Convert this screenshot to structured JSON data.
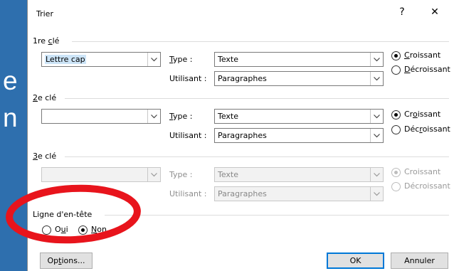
{
  "background": {
    "line1": "e",
    "line2": "n"
  },
  "dialog": {
    "title": "Trier",
    "help": "?",
    "close": "✕"
  },
  "keys": [
    {
      "label_pre": "1re ",
      "label_u": "c",
      "label_post": "lé",
      "value": "Lettre cap",
      "type_label_u": "T",
      "type_label_post": "ype :",
      "type_value": "Texte",
      "using_label": "Utilisant :",
      "using_value": "Paragraphes",
      "asc_pre": "",
      "asc_u": "C",
      "asc_post": "roissant",
      "desc_pre": "",
      "desc_u": "D",
      "desc_post": "écroissant"
    },
    {
      "label_pre": "",
      "label_u": "2",
      "label_post": "e clé",
      "value": "",
      "type_label_u": "T",
      "type_label_post": "ype :",
      "type_value": "Texte",
      "using_label": "Utilisant :",
      "using_value": "Paragraphes",
      "asc_pre": "Cr",
      "asc_u": "o",
      "asc_post": "issant",
      "desc_pre": "Déc",
      "desc_u": "r",
      "desc_post": "oissant"
    },
    {
      "label_pre": "",
      "label_u": "3",
      "label_post": "e clé",
      "value": "",
      "type_label": "Type :",
      "type_value": "Texte",
      "using_label": "Utilisant :",
      "using_value": "Paragraphes",
      "asc": "Croissant",
      "desc": "Décroissant"
    }
  ],
  "header": {
    "label": "Ligne d'en-tête",
    "yes_pre": "O",
    "yes_u": "u",
    "yes_post": "i",
    "no_pre": "",
    "no_u": "N",
    "no_post": "on"
  },
  "buttons": {
    "options_pre": "Op",
    "options_u": "t",
    "options_post": "ions...",
    "ok": "OK",
    "cancel": "Annuler"
  },
  "colors": {
    "background": "#2e6fae",
    "annotation": "#e8141c",
    "focus": "#0078d7"
  }
}
